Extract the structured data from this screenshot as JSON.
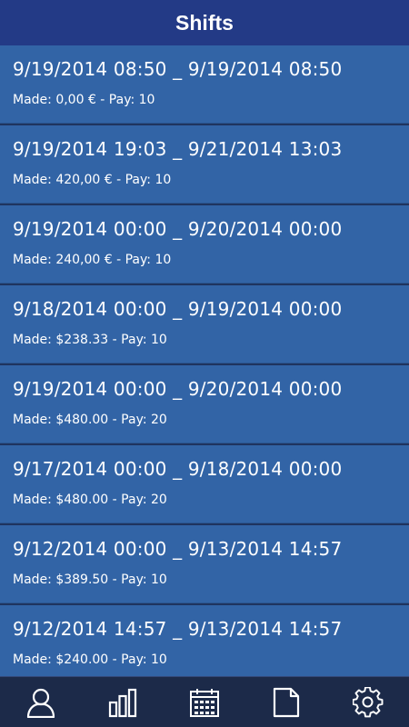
{
  "header": {
    "title": "Shifts"
  },
  "shifts": [
    {
      "range": "9/19/2014 08:50 _ 9/19/2014 08:50",
      "details": "Made: 0,00 € - Pay: 10"
    },
    {
      "range": "9/19/2014 19:03 _ 9/21/2014 13:03",
      "details": "Made: 420,00 € - Pay: 10"
    },
    {
      "range": "9/19/2014 00:00 _ 9/20/2014 00:00",
      "details": "Made: 240,00 € - Pay: 10"
    },
    {
      "range": "9/18/2014 00:00 _ 9/19/2014 00:00",
      "details": "Made: $238.33 - Pay: 10"
    },
    {
      "range": "9/19/2014 00:00 _ 9/20/2014 00:00",
      "details": "Made: $480.00 - Pay: 20"
    },
    {
      "range": "9/17/2014 00:00 _ 9/18/2014 00:00",
      "details": "Made: $480.00 - Pay: 20"
    },
    {
      "range": "9/12/2014 00:00 _ 9/13/2014 14:57",
      "details": "Made: $389.50 - Pay: 10"
    },
    {
      "range": "9/12/2014 14:57 _ 9/13/2014 14:57",
      "details": "Made: $240.00 - Pay: 10"
    }
  ],
  "tabbar": {
    "tabs": [
      {
        "icon": "user-icon"
      },
      {
        "icon": "bar-chart-icon"
      },
      {
        "icon": "calendar-icon"
      },
      {
        "icon": "document-icon"
      },
      {
        "icon": "gear-icon"
      }
    ]
  },
  "colors": {
    "header_bg": "#233a86",
    "row_bg": "#3264a6",
    "tabbar_bg": "#1c2a49",
    "text": "#ffffff"
  }
}
